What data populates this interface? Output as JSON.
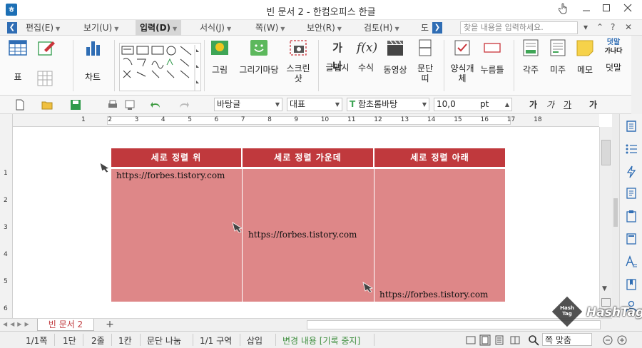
{
  "window": {
    "title": "빈 문서 2 - 한컴오피스 한글",
    "app_icon_letter": "ㅎ"
  },
  "menu": {
    "items": [
      "편집(E)",
      "보기(U)",
      "입력(D)",
      "서식(J)",
      "쪽(W)",
      "보안(R)",
      "검토(H)",
      "도"
    ],
    "active": "입력(D)",
    "search_placeholder": "찾을 내용을 입력하세요."
  },
  "ribbon": {
    "table_label": "표",
    "chart_label": "차트",
    "picture_label": "그림",
    "drawing_label": "그리기마당",
    "screenshot_label": "스크린샷",
    "glyph_label": "글맵시",
    "formula_label": "수식",
    "video_label": "동영상",
    "paragraph_label": "문단띠",
    "form_label": "양식개체",
    "button_label": "누름틀",
    "footnote_label": "각주",
    "endnote_label": "미주",
    "memo_label": "메모",
    "overlay_label": "덧말",
    "overlay_sample_top": "덧말",
    "overlay_sample_bottom": "가나다",
    "glyph_icon_text": "가나",
    "formula_icon_text": "f(x)"
  },
  "toolbar": {
    "style": "바탕글",
    "language": "대표",
    "font": "함초롬바탕",
    "font_icon": "T",
    "font_size": "10,0",
    "font_unit": "pt",
    "bold_glyph": "가",
    "italic_glyph": "가",
    "underline_glyph": "가",
    "strike_glyph": "가"
  },
  "document": {
    "table": {
      "headers": [
        "세로 정렬 위",
        "세로 정렬 가운데",
        "세로 정렬 아래"
      ],
      "cells": [
        "https://forbes.tistory.com",
        "https://forbes.tistory.com",
        "https://forbes.tistory.com"
      ]
    },
    "ruler_numbers": [
      "1",
      "2",
      "3",
      "4",
      "5",
      "6",
      "7",
      "8",
      "9",
      "10",
      "11",
      "12",
      "13",
      "14",
      "15",
      "16",
      "17",
      "18"
    ],
    "left_ruler_numbers": [
      "1",
      "2",
      "3",
      "4",
      "5",
      "6"
    ]
  },
  "sheet_tabs": {
    "active": "빈 문서 2",
    "add": "+"
  },
  "status": {
    "page": "1/1쪽",
    "column": "1단",
    "line": "2줄",
    "cell": "1칸",
    "paragraph": "문단 나눔",
    "section": "1/1 구역",
    "insert_mode": "삽입",
    "track_changes": "변경 내용 [기록 중지]",
    "zoom": "쪽 맞춤"
  },
  "watermark": {
    "brand": "HashTag",
    "badge": "Hash Tag"
  },
  "colors": {
    "header_bg": "#c0393d",
    "cell_bg": "#de8788",
    "accent": "#1c6fb5"
  }
}
